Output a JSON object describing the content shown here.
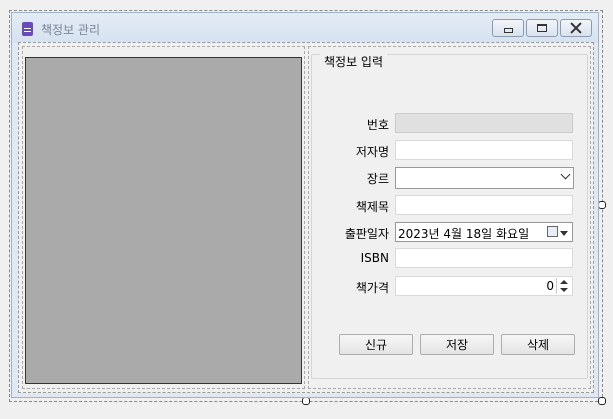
{
  "window": {
    "title": "책정보 관리",
    "icon": "book-icon",
    "accent": "#6b4ab8"
  },
  "group": {
    "title": "책정보 입력"
  },
  "fields": {
    "number": {
      "label": "번호",
      "value": ""
    },
    "author": {
      "label": "저자명",
      "value": ""
    },
    "genre": {
      "label": "장르",
      "value": ""
    },
    "book_title": {
      "label": "책제목",
      "value": ""
    },
    "publish_date": {
      "label": "출판일자",
      "value": "2023년   4월 18일 화요일"
    },
    "isbn": {
      "label": "ISBN",
      "value": ""
    },
    "price": {
      "label": "책가격",
      "value": "0"
    }
  },
  "buttons": {
    "new": "신규",
    "save": "저장",
    "delete": "삭제"
  }
}
